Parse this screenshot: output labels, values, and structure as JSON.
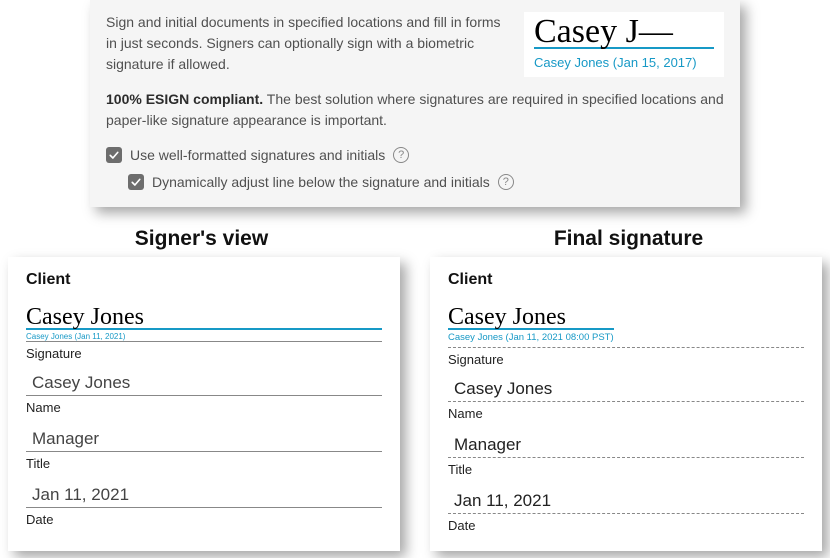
{
  "info": {
    "intro": "Sign and initial documents in specified locations and fill in forms in just seconds. Signers can optionally sign with a biometric signature if allowed.",
    "sample_signature_name": "Casey Jones",
    "sample_signature_caption": "Casey Jones (Jan 15, 2017)",
    "compliance_strong": "100% ESIGN compliant.",
    "compliance_rest": " The best solution where signatures are required in specified locations and paper-like signature appearance is important.",
    "option1": "Use well-formatted signatures and initials",
    "option2": "Dynamically adjust line below the signature and initials"
  },
  "labels": {
    "signer_view": "Signer's view",
    "final_signature": "Final signature",
    "client": "Client",
    "signature": "Signature",
    "name": "Name",
    "title": "Title",
    "date": "Date"
  },
  "signer": {
    "sig_name": "Casey Jones",
    "sig_stamp": "Casey Jones   (Jan 11, 2021)",
    "name": "Casey Jones",
    "title": "Manager",
    "date": "Jan 11, 2021"
  },
  "final": {
    "sig_name": "Casey Jones",
    "sig_stamp": "Casey Jones (Jan 11, 2021 08:00 PST)",
    "name": "Casey Jones",
    "title": "Manager",
    "date": "Jan 11, 2021"
  }
}
